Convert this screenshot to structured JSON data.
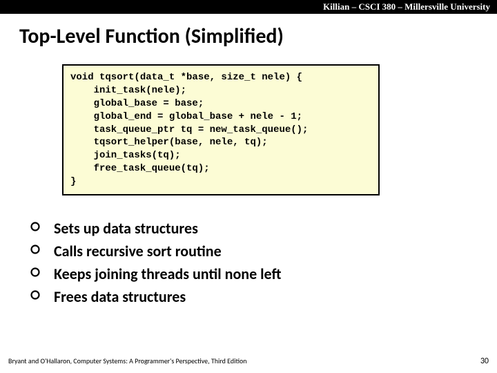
{
  "header": "Killian – CSCI 380 – Millersville University",
  "title": "Top-Level Function (Simplified)",
  "code": "void tqsort(data_t *base, size_t nele) {\n    init_task(nele);\n    global_base = base;\n    global_end = global_base + nele - 1;\n    task_queue_ptr tq = new_task_queue();\n    tqsort_helper(base, nele, tq);\n    join_tasks(tq);\n    free_task_queue(tq);\n}",
  "bullets": [
    "Sets up data structures",
    "Calls recursive sort routine",
    "Keeps joining threads until none left",
    "Frees data structures"
  ],
  "footer_left": "Bryant and O'Hallaron, Computer Systems: A Programmer's Perspective, Third Edition",
  "page_number": "30"
}
